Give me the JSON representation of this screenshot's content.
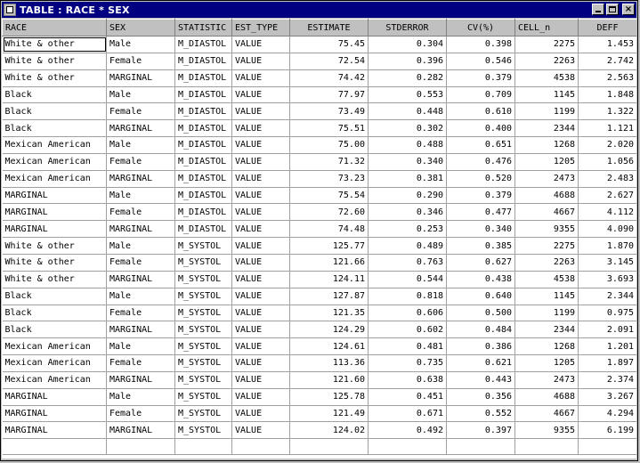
{
  "window": {
    "title": "TABLE : RACE * SEX",
    "buttons": {
      "minimize": "",
      "maximize": "",
      "close": "×"
    }
  },
  "table": {
    "columns": [
      "RACE",
      "SEX",
      "STATISTIC",
      "EST_TYPE",
      "ESTIMATE",
      "STDERROR",
      "CV(%)",
      "CELL_n",
      "DEFF"
    ],
    "rows": [
      [
        "White & other",
        "Male",
        "M_DIASTOL",
        "VALUE",
        "75.45",
        "0.304",
        "0.398",
        "2275",
        "1.453"
      ],
      [
        "White & other",
        "Female",
        "M_DIASTOL",
        "VALUE",
        "72.54",
        "0.396",
        "0.546",
        "2263",
        "2.742"
      ],
      [
        "White & other",
        "MARGINAL",
        "M_DIASTOL",
        "VALUE",
        "74.42",
        "0.282",
        "0.379",
        "4538",
        "2.563"
      ],
      [
        "Black",
        "Male",
        "M_DIASTOL",
        "VALUE",
        "77.97",
        "0.553",
        "0.709",
        "1145",
        "1.848"
      ],
      [
        "Black",
        "Female",
        "M_DIASTOL",
        "VALUE",
        "73.49",
        "0.448",
        "0.610",
        "1199",
        "1.322"
      ],
      [
        "Black",
        "MARGINAL",
        "M_DIASTOL",
        "VALUE",
        "75.51",
        "0.302",
        "0.400",
        "2344",
        "1.121"
      ],
      [
        "Mexican American",
        "Male",
        "M_DIASTOL",
        "VALUE",
        "75.00",
        "0.488",
        "0.651",
        "1268",
        "2.020"
      ],
      [
        "Mexican American",
        "Female",
        "M_DIASTOL",
        "VALUE",
        "71.32",
        "0.340",
        "0.476",
        "1205",
        "1.056"
      ],
      [
        "Mexican American",
        "MARGINAL",
        "M_DIASTOL",
        "VALUE",
        "73.23",
        "0.381",
        "0.520",
        "2473",
        "2.483"
      ],
      [
        "MARGINAL",
        "Male",
        "M_DIASTOL",
        "VALUE",
        "75.54",
        "0.290",
        "0.379",
        "4688",
        "2.627"
      ],
      [
        "MARGINAL",
        "Female",
        "M_DIASTOL",
        "VALUE",
        "72.60",
        "0.346",
        "0.477",
        "4667",
        "4.112"
      ],
      [
        "MARGINAL",
        "MARGINAL",
        "M_DIASTOL",
        "VALUE",
        "74.48",
        "0.253",
        "0.340",
        "9355",
        "4.090"
      ],
      [
        "White & other",
        "Male",
        "M_SYSTOL",
        "VALUE",
        "125.77",
        "0.489",
        "0.385",
        "2275",
        "1.870"
      ],
      [
        "White & other",
        "Female",
        "M_SYSTOL",
        "VALUE",
        "121.66",
        "0.763",
        "0.627",
        "2263",
        "3.145"
      ],
      [
        "White & other",
        "MARGINAL",
        "M_SYSTOL",
        "VALUE",
        "124.11",
        "0.544",
        "0.438",
        "4538",
        "3.693"
      ],
      [
        "Black",
        "Male",
        "M_SYSTOL",
        "VALUE",
        "127.87",
        "0.818",
        "0.640",
        "1145",
        "2.344"
      ],
      [
        "Black",
        "Female",
        "M_SYSTOL",
        "VALUE",
        "121.35",
        "0.606",
        "0.500",
        "1199",
        "0.975"
      ],
      [
        "Black",
        "MARGINAL",
        "M_SYSTOL",
        "VALUE",
        "124.29",
        "0.602",
        "0.484",
        "2344",
        "2.091"
      ],
      [
        "Mexican American",
        "Male",
        "M_SYSTOL",
        "VALUE",
        "124.61",
        "0.481",
        "0.386",
        "1268",
        "1.201"
      ],
      [
        "Mexican American",
        "Female",
        "M_SYSTOL",
        "VALUE",
        "113.36",
        "0.735",
        "0.621",
        "1205",
        "1.897"
      ],
      [
        "Mexican American",
        "MARGINAL",
        "M_SYSTOL",
        "VALUE",
        "121.60",
        "0.638",
        "0.443",
        "2473",
        "2.374"
      ],
      [
        "MARGINAL",
        "Male",
        "M_SYSTOL",
        "VALUE",
        "125.78",
        "0.451",
        "0.356",
        "4688",
        "3.267"
      ],
      [
        "MARGINAL",
        "Female",
        "M_SYSTOL",
        "VALUE",
        "121.49",
        "0.671",
        "0.552",
        "4667",
        "4.294"
      ],
      [
        "MARGINAL",
        "MARGINAL",
        "M_SYSTOL",
        "VALUE",
        "124.02",
        "0.492",
        "0.397",
        "9355",
        "6.199"
      ]
    ]
  }
}
